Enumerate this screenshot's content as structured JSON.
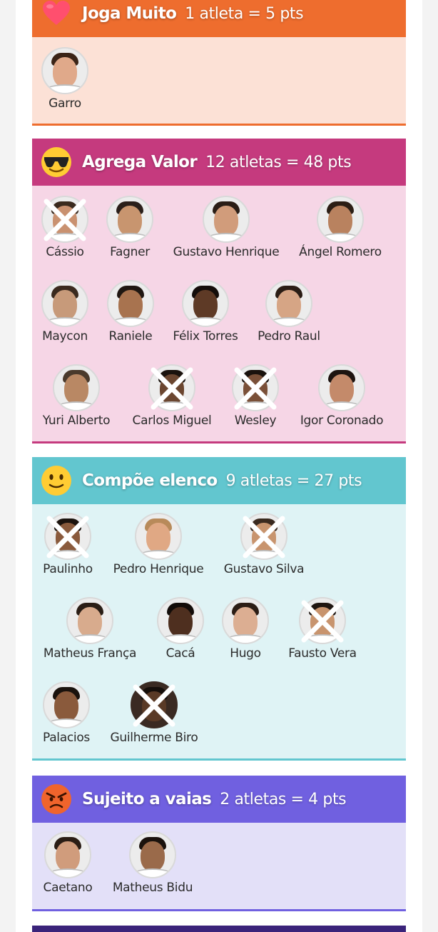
{
  "sections": {
    "joga": {
      "title": "Joga Muito",
      "count": "1 atleta = 5 pts",
      "emoji": "heart-emoji",
      "header_color": "#ee6d2e",
      "body_color": "#fce1d6",
      "border_color": "#ee6d2e",
      "players": [
        {
          "name": "Garro",
          "crossed": false
        }
      ]
    },
    "agrega": {
      "title": "Agrega Valor",
      "count": "12 atletas = 48 pts",
      "emoji": "sunglasses-face-emoji",
      "header_color": "#c53a7e",
      "body_color": "#f6d6e6",
      "border_color": "#c53a7e",
      "players": [
        {
          "name": "Cássio",
          "crossed": true
        },
        {
          "name": "Fagner",
          "crossed": false
        },
        {
          "name": "Gustavo Henrique",
          "crossed": false
        },
        {
          "name": "Ángel Romero",
          "crossed": false
        },
        {
          "name": "Maycon",
          "crossed": false
        },
        {
          "name": "Raniele",
          "crossed": false
        },
        {
          "name": "Félix Torres",
          "crossed": false
        },
        {
          "name": "Pedro Raul",
          "crossed": false
        },
        {
          "name": "Yuri Alberto",
          "crossed": false
        },
        {
          "name": "Carlos Miguel",
          "crossed": true
        },
        {
          "name": "Wesley",
          "crossed": true
        },
        {
          "name": "Igor Coronado",
          "crossed": false
        }
      ]
    },
    "compoe": {
      "title": "Compõe elenco",
      "count": "9 atletas = 27 pts",
      "emoji": "slightly-smiling-face-emoji",
      "header_color": "#62c6cf",
      "body_color": "#dff3f5",
      "border_color": "#62c6cf",
      "players": [
        {
          "name": "Paulinho",
          "crossed": true
        },
        {
          "name": "Pedro Henrique",
          "crossed": false
        },
        {
          "name": "Gustavo Silva",
          "crossed": true
        },
        {
          "name": "Matheus França",
          "crossed": false
        },
        {
          "name": "Cacá",
          "crossed": false
        },
        {
          "name": "Hugo",
          "crossed": false
        },
        {
          "name": "Fausto Vera",
          "crossed": true
        },
        {
          "name": "Palacios",
          "crossed": false
        },
        {
          "name": "Guilherme Biro",
          "crossed": true
        }
      ]
    },
    "sujeito": {
      "title": "Sujeito a vaias",
      "count": "2 atletas = 4 pts",
      "emoji": "angry-face-emoji",
      "header_color": "#7060e0",
      "body_color": "#e3e0f8",
      "border_color": "#7060e0",
      "players": [
        {
          "name": "Caetano",
          "crossed": false
        },
        {
          "name": "Matheus Bidu",
          "crossed": false
        }
      ]
    }
  }
}
